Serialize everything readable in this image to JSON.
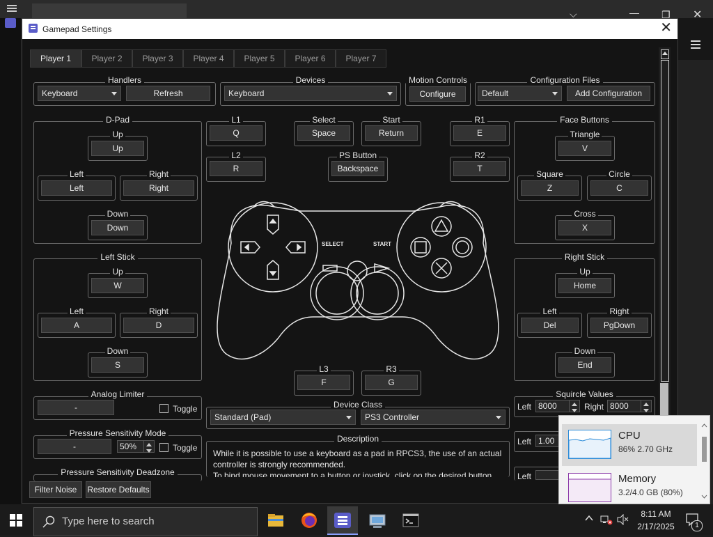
{
  "window": {
    "title": "Gamepad Settings"
  },
  "tabs": [
    "Player 1",
    "Player 2",
    "Player 3",
    "Player 4",
    "Player 5",
    "Player 6",
    "Player 7"
  ],
  "handlers": {
    "title": "Handlers",
    "value": "Keyboard",
    "refresh": "Refresh"
  },
  "devices": {
    "title": "Devices",
    "value": "Keyboard"
  },
  "motion": {
    "title": "Motion Controls",
    "configure": "Configure"
  },
  "configfiles": {
    "title": "Configuration Files",
    "value": "Default",
    "add": "Add Configuration"
  },
  "dpad": {
    "title": "D-Pad",
    "up_label": "Up",
    "up": "Up",
    "left_label": "Left",
    "left": "Left",
    "right_label": "Right",
    "right": "Right",
    "down_label": "Down",
    "down": "Down"
  },
  "leftstick": {
    "title": "Left Stick",
    "up_label": "Up",
    "up": "W",
    "left_label": "Left",
    "left": "A",
    "right_label": "Right",
    "right": "D",
    "down_label": "Down",
    "down": "S"
  },
  "face": {
    "title": "Face Buttons",
    "triangle_label": "Triangle",
    "triangle": "V",
    "square_label": "Square",
    "square": "Z",
    "circle_label": "Circle",
    "circle": "C",
    "cross_label": "Cross",
    "cross": "X"
  },
  "rightstick": {
    "title": "Right Stick",
    "up_label": "Up",
    "up": "Home",
    "left_label": "Left",
    "left": "Del",
    "right_label": "Right",
    "right": "PgDown",
    "down_label": "Down",
    "down": "End"
  },
  "center": {
    "l1_label": "L1",
    "l1": "Q",
    "l2_label": "L2",
    "l2": "R",
    "select_label": "Select",
    "select": "Space",
    "start_label": "Start",
    "start": "Return",
    "ps_label": "PS Button",
    "ps": "Backspace",
    "r1_label": "R1",
    "r1": "E",
    "r2_label": "R2",
    "r2": "T",
    "l3_label": "L3",
    "l3": "F",
    "r3_label": "R3",
    "r3": "G",
    "controller_select": "SELECT",
    "controller_start": "START"
  },
  "analog_limiter": {
    "title": "Analog Limiter",
    "value": "-",
    "toggle": "Toggle"
  },
  "pressure_mode": {
    "title": "Pressure Sensitivity Mode",
    "value": "-",
    "percent": "50%",
    "toggle": "Toggle"
  },
  "pressure_deadzone": {
    "title": "Pressure Sensitivity Deadzone"
  },
  "device_class": {
    "title": "Device Class",
    "class": "Standard (Pad)",
    "type": "PS3 Controller"
  },
  "description": {
    "title": "Description",
    "lines": [
      "While it is possible to use a keyboard as a pad in RPCS3, the use of an actual",
      "controller is strongly recommended.",
      "To bind mouse movement to a button or joystick, click on the desired button"
    ]
  },
  "squircle": {
    "title": "Squircle Values",
    "left_label": "Left",
    "left": "8000",
    "right_label": "Right",
    "right": "8000"
  },
  "extra_left_label": "Left",
  "extra_left_value": "1.00",
  "extra_left_label2": "Left",
  "footer": {
    "filter": "Filter Noise",
    "restore": "Restore Defaults"
  },
  "taskbar": {
    "search_placeholder": "Type here to search",
    "time": "8:11 AM",
    "date": "2/17/2025",
    "notif_count": "1"
  },
  "taskmanager": {
    "cpu_name": "CPU",
    "cpu_value": "86%  2.70 GHz",
    "mem_name": "Memory",
    "mem_value": "3.2/4.0 GB (80%)"
  },
  "colors": {
    "accent": "#5a5cc8",
    "cpu_graph": "#2b8bd8",
    "mem_graph": "#8b3aa8"
  }
}
